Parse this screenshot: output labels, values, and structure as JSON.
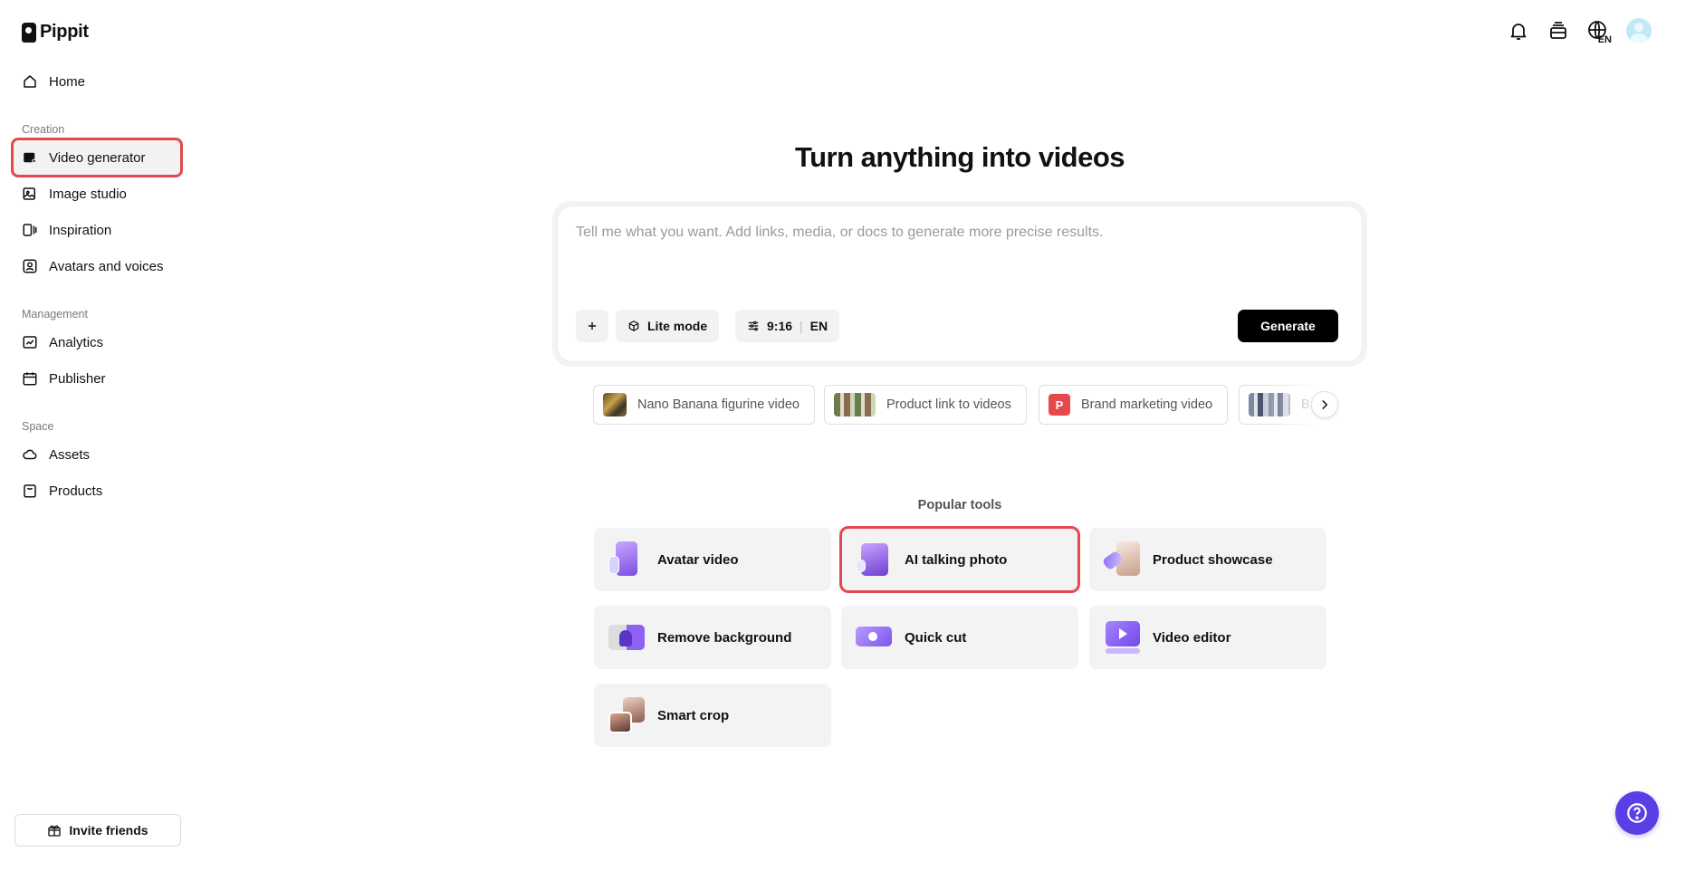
{
  "app": {
    "name": "Pippit"
  },
  "sidebar": {
    "items": [
      {
        "label": "Home",
        "icon": "home-icon"
      },
      {
        "label": "Video generator",
        "icon": "video-generator-icon"
      },
      {
        "label": "Image studio",
        "icon": "image-icon"
      },
      {
        "label": "Inspiration",
        "icon": "inspiration-icon"
      },
      {
        "label": "Avatars and voices",
        "icon": "avatar-icon"
      },
      {
        "label": "Analytics",
        "icon": "analytics-icon"
      },
      {
        "label": "Publisher",
        "icon": "calendar-icon"
      },
      {
        "label": "Assets",
        "icon": "cloud-icon"
      },
      {
        "label": "Products",
        "icon": "products-icon"
      }
    ],
    "sections": {
      "creation": "Creation",
      "management": "Management",
      "space": "Space"
    },
    "invite_label": "Invite friends"
  },
  "topbar": {
    "language": "EN"
  },
  "main": {
    "headline": "Turn anything into videos",
    "prompt_placeholder": "Tell me what you want. Add links, media, or docs to generate more precise results.",
    "mode_label": "Lite mode",
    "ratio_label": "9:16",
    "lang_label": "EN",
    "generate_label": "Generate"
  },
  "templates": [
    {
      "label": "Nano Banana figurine video"
    },
    {
      "label": "Product link to videos"
    },
    {
      "label": "Brand marketing video",
      "badge": "P"
    },
    {
      "label": "B"
    }
  ],
  "popular": {
    "title": "Popular tools",
    "tools": [
      {
        "label": "Avatar video"
      },
      {
        "label": "AI talking photo"
      },
      {
        "label": "Product showcase"
      },
      {
        "label": "Remove background"
      },
      {
        "label": "Quick cut"
      },
      {
        "label": "Video editor"
      },
      {
        "label": "Smart crop"
      }
    ]
  },
  "colors": {
    "accent": "#5a3ee6",
    "highlight": "#e5484d",
    "primary_button": "#000000"
  }
}
